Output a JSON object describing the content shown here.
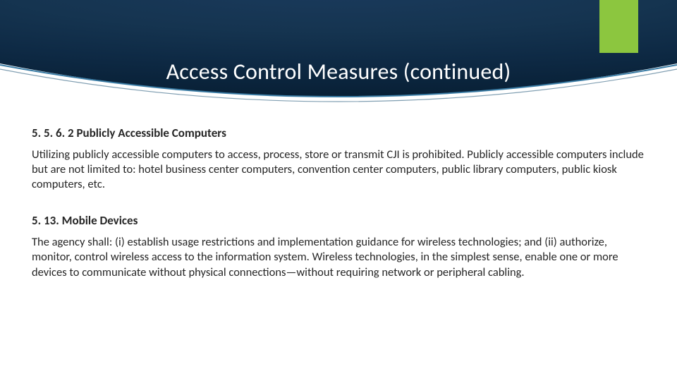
{
  "title": "Access Control Measures (continued)",
  "sections": [
    {
      "heading": "5. 5. 6. 2 Publicly Accessible Computers",
      "para": "Utilizing publicly accessible computers to access, process, store or transmit CJI is prohibited. Publicly accessible computers include but are not limited to: hotel business center computers, convention center computers, public library computers, public kiosk computers, etc."
    },
    {
      "heading": "5. 13. Mobile Devices",
      "para": "The agency shall: (i) establish usage restrictions and implementation guidance for wireless technologies; and (ii) authorize, monitor, control wireless access to the information system. Wireless technologies, in the simplest sense, enable one or more devices to communicate without physical connections—without requiring network or peripheral cabling."
    }
  ]
}
